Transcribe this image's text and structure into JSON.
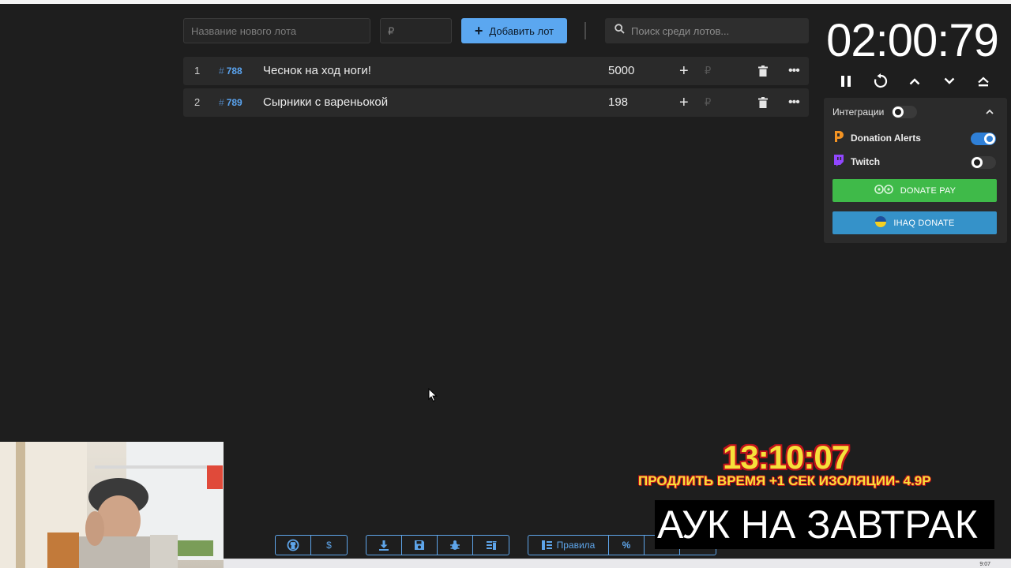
{
  "toolbar": {
    "lot_name_placeholder": "Название нового лота",
    "amount_placeholder": "₽",
    "add_lot_label": "Добавить лот",
    "search_placeholder": "Поиск среди лотов..."
  },
  "lots": [
    {
      "index": "1",
      "id": "788",
      "name": "Чеснок на ход ноги!",
      "amount": "5000"
    },
    {
      "index": "2",
      "id": "789",
      "name": "Сырники с вареньокой",
      "amount": "198"
    }
  ],
  "lot_currency": "₽",
  "timer": {
    "display": "02:00:79"
  },
  "integrations": {
    "title": "Интеграции",
    "enabled": false,
    "services": [
      {
        "name": "Donation Alerts",
        "enabled": true,
        "icon": "donation-alerts-icon"
      },
      {
        "name": "Twitch",
        "enabled": false,
        "icon": "twitch-icon"
      }
    ],
    "donatepay_label": "DONATE PAY",
    "ihaq_label": "IHAQ DONATE"
  },
  "bottom_toolbar": {
    "dollar_label": "$",
    "rules_label": "Правила",
    "percent_label": "%"
  },
  "overlays": {
    "clock": "13:10:07",
    "extend_text": "ПРОДЛИТЬ ВРЕМЯ +1 СЕК ИЗОЛЯЦИИ- 4.9Р",
    "title": "АУК НА ЗАВТРАК"
  },
  "taskbar_time": "9:07",
  "colors": {
    "background": "#1e1e1e",
    "accent": "#5ba7f0",
    "donatepay": "#3fba49",
    "ihaq": "#3592c9",
    "toggle_on": "#2f80d8",
    "overlay_yellow": "#f6e13a",
    "overlay_red": "#c0131b"
  }
}
